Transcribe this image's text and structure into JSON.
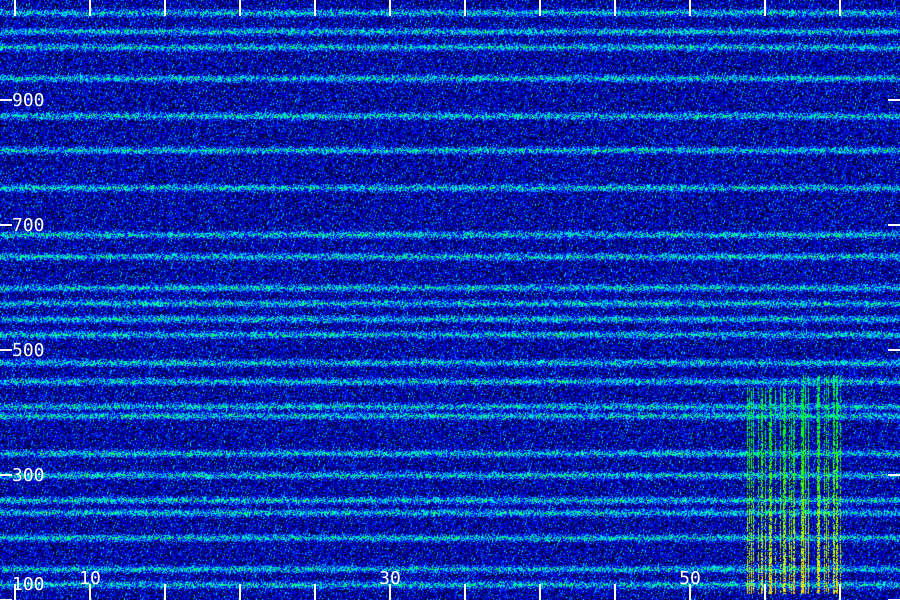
{
  "chart_data": {
    "type": "heatmap",
    "title": "",
    "xlabel": "",
    "ylabel": "",
    "xlim": [
      4,
      64
    ],
    "ylim": [
      100,
      1060
    ],
    "x_tick_labels": [
      {
        "value": 10,
        "label": "10"
      },
      {
        "value": 30,
        "label": "30"
      },
      {
        "value": 50,
        "label": "50"
      }
    ],
    "x_minor_ticks": [
      5,
      10,
      15,
      20,
      25,
      30,
      35,
      40,
      45,
      50,
      55,
      60
    ],
    "y_tick_labels": [
      {
        "value": 900,
        "label": "900"
      },
      {
        "value": 700,
        "label": "700"
      },
      {
        "value": 500,
        "label": "500"
      },
      {
        "value": 300,
        "label": "300"
      },
      {
        "value": 100,
        "label": "100"
      }
    ],
    "colormap": [
      "#000000",
      "#000080",
      "#0000ff",
      "#00ffff",
      "#00ff00",
      "#ffff00",
      "#ff0000"
    ],
    "horizontal_bands_y": [
      1040,
      1010,
      985,
      935,
      875,
      820,
      760,
      685,
      650,
      600,
      575,
      550,
      525,
      480,
      450,
      410,
      395,
      335,
      300,
      260,
      240,
      200,
      150,
      125
    ],
    "bursts": [
      {
        "x": [
          53.5,
          58.0
        ],
        "y": [
          110,
          440
        ],
        "intensity": "high"
      },
      {
        "x": [
          57.5,
          60.0
        ],
        "y": [
          110,
          460
        ],
        "intensity": "high"
      }
    ],
    "grid": false,
    "legend": "none"
  }
}
